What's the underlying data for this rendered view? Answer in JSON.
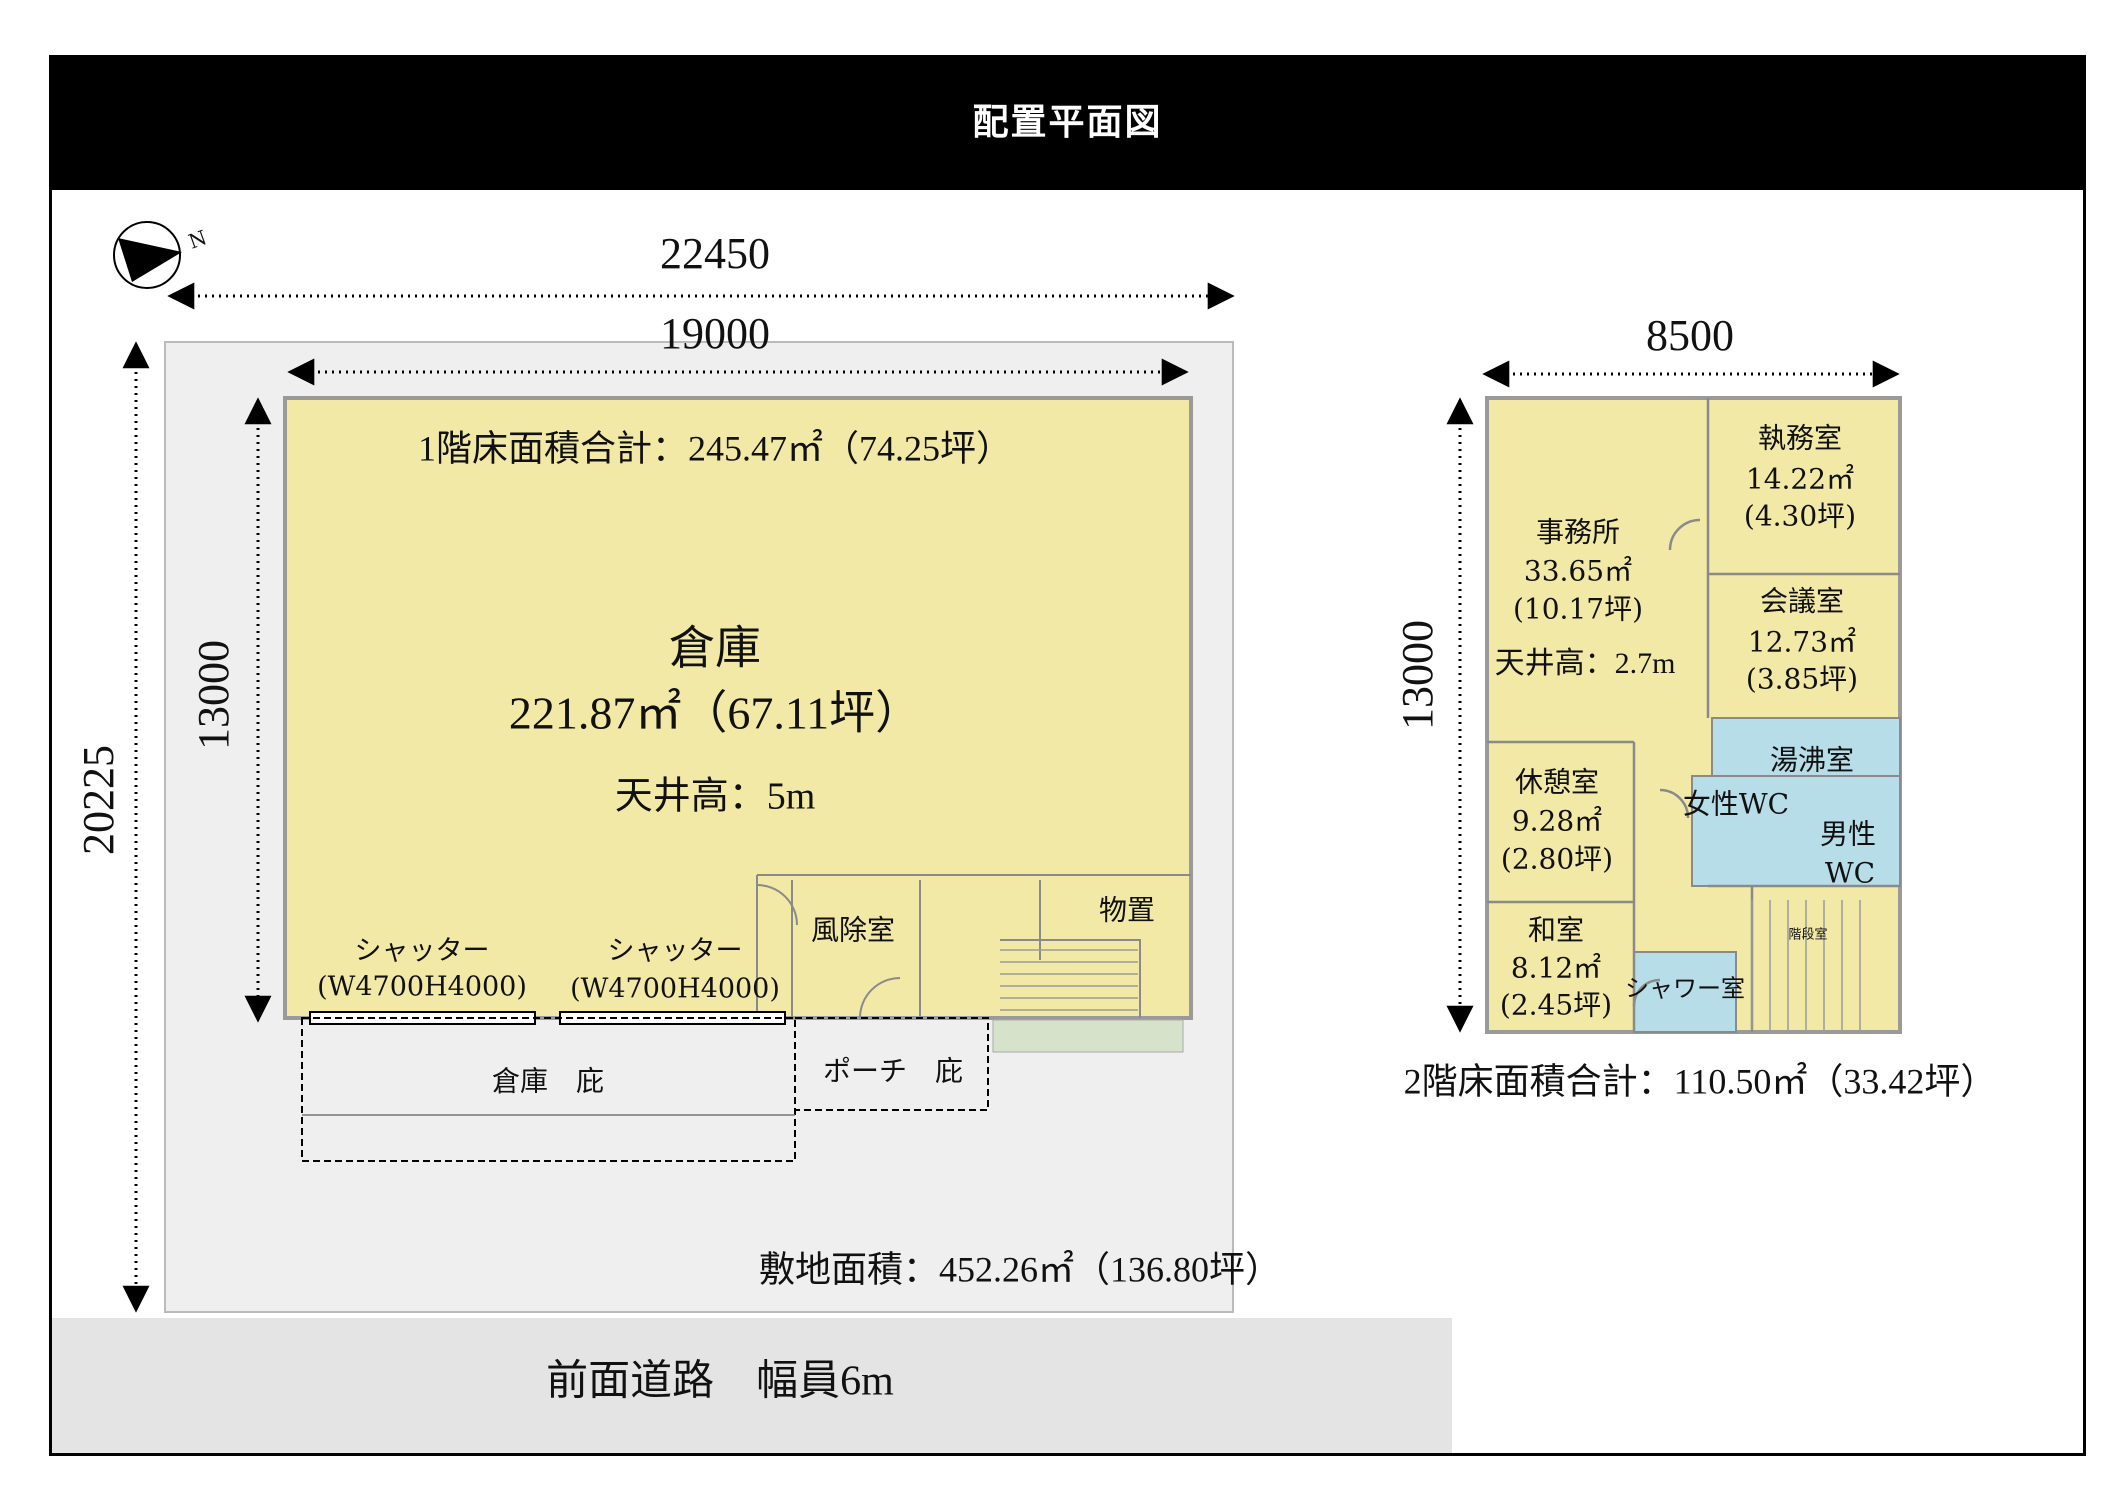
{
  "header": {
    "title": "配置平面図"
  },
  "compass": {
    "label": "N"
  },
  "site": {
    "dim_total_width": "22450",
    "dim_building_width": "19000",
    "dim_depth_total": "20225",
    "dim_building_depth": "13000",
    "area_label": "敷地面積：452.26㎡（136.80坪）",
    "road_label": "前面道路　幅員6m"
  },
  "floor1": {
    "total_label": "1階床面積合計：245.47㎡（74.25坪）",
    "warehouse": {
      "name": "倉庫",
      "area": "221.87㎡（67.11坪）",
      "ceiling": "天井高：5m"
    },
    "shutter1": {
      "name": "シャッター",
      "size": "(W4700H4000)"
    },
    "shutter2": {
      "name": "シャッター",
      "size": "(W4700H4000)"
    },
    "windbreak": "風除室",
    "storage": "物置",
    "eave_warehouse": "倉庫　庇",
    "eave_porch": "ポーチ　庇"
  },
  "floor2": {
    "dim_width": "8500",
    "dim_depth": "13000",
    "total_label": "2階床面積合計：110.50㎡（33.42坪）",
    "office": {
      "name": "事務所",
      "area": "33.65㎡",
      "tsubo": "(10.17坪)",
      "ceiling": "天井高：2.7m"
    },
    "exec": {
      "name": "執務室",
      "area": "14.22㎡",
      "tsubo": "(4.30坪)"
    },
    "meeting": {
      "name": "会議室",
      "area": "12.73㎡",
      "tsubo": "(3.85坪)"
    },
    "kitchen": "湯沸室",
    "wc_female": "女性WC",
    "wc_male_1": "男性",
    "wc_male_2": "WC",
    "rest": {
      "name": "休憩室",
      "area": "9.28㎡",
      "tsubo": "(2.80坪)"
    },
    "japanese": {
      "name": "和室",
      "area": "8.12㎡",
      "tsubo": "(2.45坪)"
    },
    "shower": "シャワー室",
    "stair_small": "階段室"
  },
  "colors": {
    "yellow": "#f3e9a6",
    "blue": "#b7dde8",
    "site_gray": "#efefef",
    "road_gray": "#e4e4e4"
  }
}
